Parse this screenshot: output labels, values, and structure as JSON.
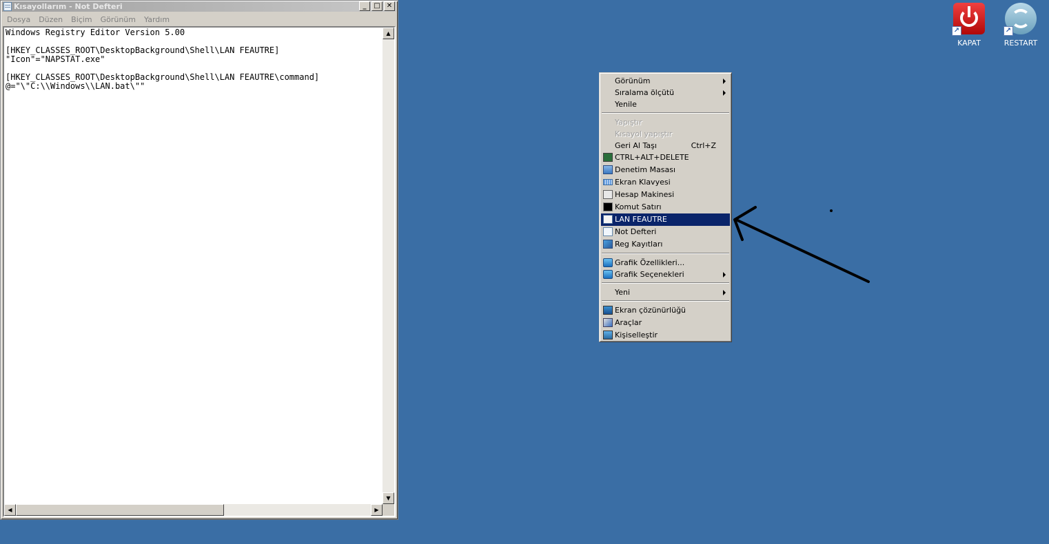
{
  "notepad": {
    "title": "Kısayollarım - Not Defteri",
    "controls": {
      "minimize": "_",
      "maximize": "□",
      "close": "✕"
    },
    "menu": [
      "Dosya",
      "Düzen",
      "Biçim",
      "Görünüm",
      "Yardım"
    ],
    "content": "Windows Registry Editor Version 5.00\n\n[HKEY_CLASSES_ROOT\\DesktopBackground\\Shell\\LAN FEAUTRE]\n\"Icon\"=\"NAPSTAT.exe\"\n\n[HKEY_CLASSES_ROOT\\DesktopBackground\\Shell\\LAN FEAUTRE\\command]\n@=\"\\\"C:\\\\Windows\\\\LAN.bat\\\"\""
  },
  "desktop": {
    "background_color": "#3a6ea5",
    "icons": [
      {
        "label": "KAPAT",
        "icon": "power-icon"
      },
      {
        "label": "RESTART",
        "icon": "restart-icon"
      }
    ]
  },
  "context_menu": {
    "items": [
      {
        "label": "Görünüm",
        "submenu": true
      },
      {
        "label": "Sıralama ölçütü",
        "submenu": true
      },
      {
        "label": "Yenile"
      },
      {
        "label": "Yapıştır",
        "disabled": true
      },
      {
        "label": "Kısayol yapıştır",
        "disabled": true
      },
      {
        "label": "Geri Al Taşı",
        "shortcut": "Ctrl+Z"
      },
      {
        "label": "CTRL+ALT+DELETE",
        "icon": "monitor-icon"
      },
      {
        "label": "Denetim Masası",
        "icon": "control-panel-icon"
      },
      {
        "label": "Ekran Klavyesi",
        "icon": "keyboard-icon"
      },
      {
        "label": "Hesap Makinesi",
        "icon": "calculator-icon"
      },
      {
        "label": "Komut Satırı",
        "icon": "command-prompt-icon"
      },
      {
        "label": "LAN FEAUTRE",
        "icon": "network-icon",
        "selected": true
      },
      {
        "label": "Not Defteri",
        "icon": "notepad-icon"
      },
      {
        "label": "Reg Kayıtları",
        "icon": "registry-icon"
      },
      {
        "label": "Grafik Özellikleri...",
        "icon": "graphics-icon"
      },
      {
        "label": "Grafik Seçenekleri",
        "icon": "graphics-icon",
        "submenu": true
      },
      {
        "label": "Yeni",
        "submenu": true
      },
      {
        "label": "Ekran çözünürlüğü",
        "icon": "display-icon"
      },
      {
        "label": "Araçlar",
        "icon": "tools-icon"
      },
      {
        "label": "Kişiselleştir",
        "icon": "personalize-icon"
      }
    ],
    "selection_color": "#0a246a"
  }
}
